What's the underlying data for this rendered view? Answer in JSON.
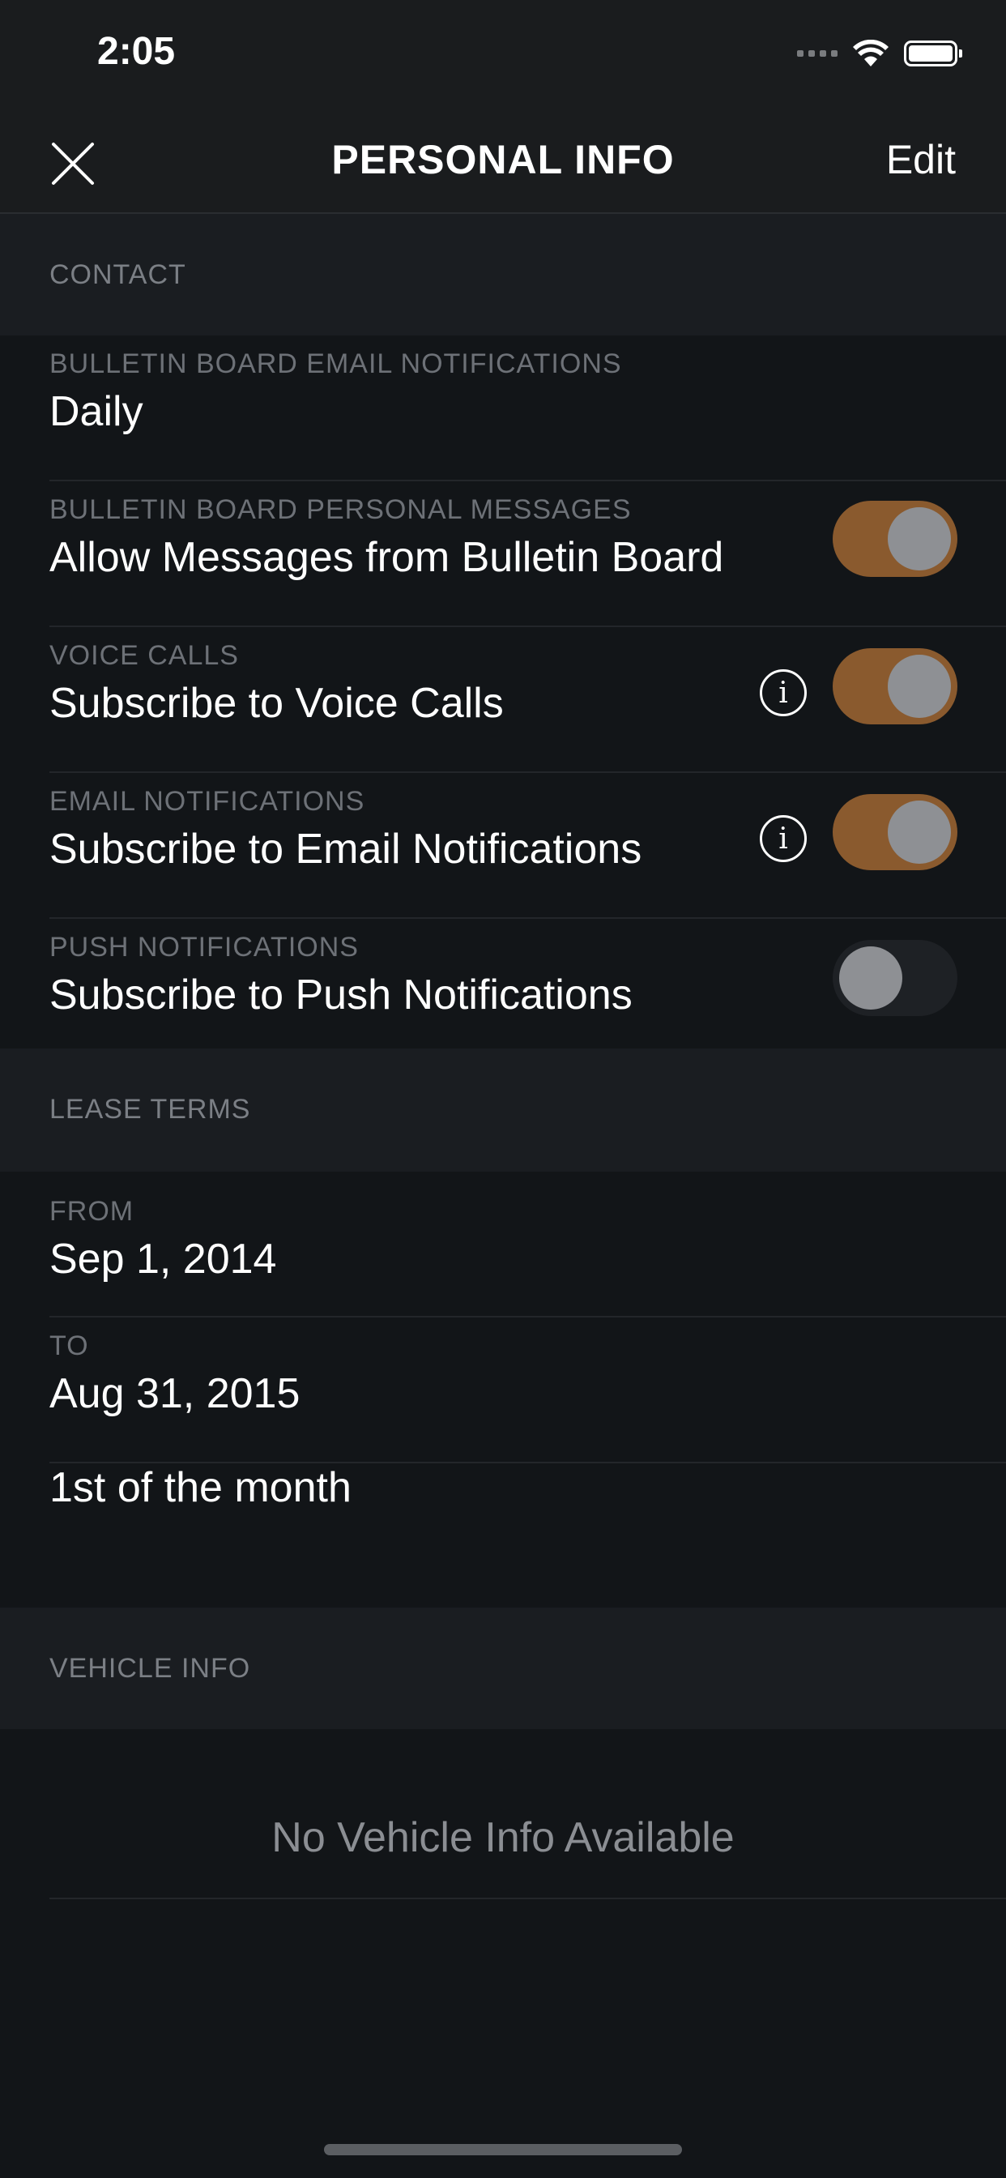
{
  "status_bar": {
    "time": "2:05"
  },
  "nav": {
    "title": "PERSONAL INFO",
    "edit_label": "Edit",
    "close_icon": "close-icon"
  },
  "sections": {
    "contact": "CONTACT",
    "lease_terms": "LEASE TERMS",
    "vehicle_info": "VEHICLE INFO"
  },
  "contact_rows": {
    "bulletin_email": {
      "label": "BULLETIN BOARD EMAIL NOTIFICATIONS",
      "value": "Daily"
    },
    "bulletin_messages": {
      "label": "BULLETIN BOARD PERSONAL MESSAGES",
      "value": "Allow Messages from Bulletin Board",
      "toggle_on": true
    },
    "voice_calls": {
      "label": "VOICE CALLS",
      "value": "Subscribe to Voice Calls",
      "toggle_on": true,
      "has_info": true
    },
    "email_notifications": {
      "label": "EMAIL NOTIFICATIONS",
      "value": "Subscribe to Email Notifications",
      "toggle_on": true,
      "has_info": true
    },
    "push_notifications": {
      "label": "PUSH NOTIFICATIONS",
      "value": "Subscribe to Push Notifications",
      "toggle_on": false
    }
  },
  "lease_rows": {
    "from": {
      "label": "FROM",
      "value": "Sep 1, 2014"
    },
    "to": {
      "label": "TO",
      "value": "Aug 31, 2015"
    },
    "due_day": "1st of the month"
  },
  "vehicle": {
    "empty_message": "No Vehicle Info Available"
  },
  "colors": {
    "background": "#121518",
    "header_background": "#1a1c1e",
    "section_background": "#1a1d21",
    "toggle_on": "#8a5a2e",
    "toggle_off": "#1e2125",
    "knob": "#8e9094",
    "label_gray": "#6d7177"
  },
  "info_glyph": "i"
}
